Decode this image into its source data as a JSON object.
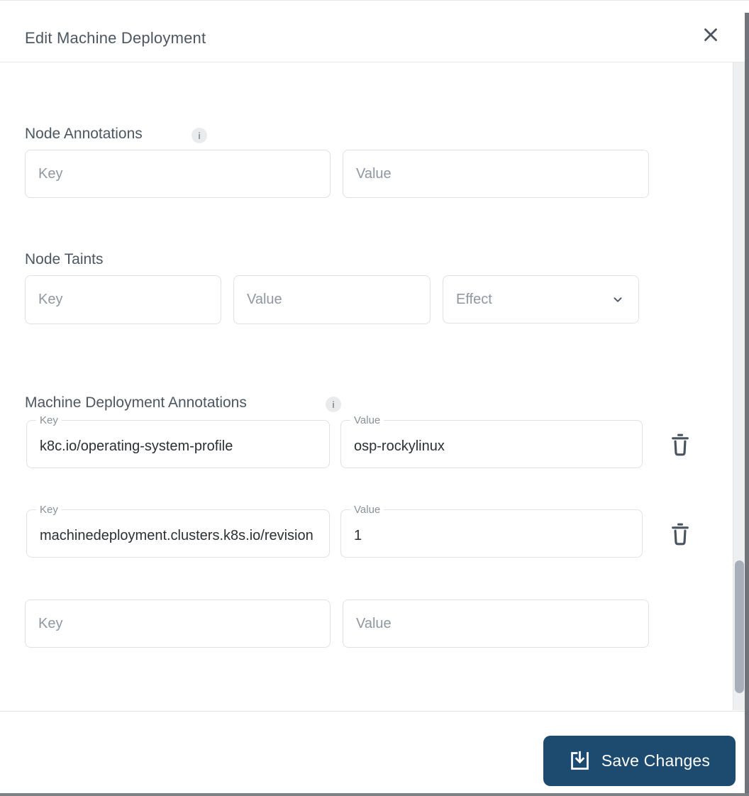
{
  "dialog": {
    "title": "Edit Machine Deployment",
    "info_glyph": "i"
  },
  "node_annotations": {
    "heading": "Node Annotations",
    "key_placeholder": "Key",
    "value_placeholder": "Value"
  },
  "node_taints": {
    "heading": "Node Taints",
    "key_placeholder": "Key",
    "value_placeholder": "Value",
    "effect_placeholder": "Effect"
  },
  "md_annotations": {
    "heading": "Machine Deployment Annotations",
    "rows": [
      {
        "key_label": "Key",
        "key": "k8c.io/operating-system-profile",
        "value_label": "Value",
        "value": "osp-rockylinux"
      },
      {
        "key_label": "Key",
        "key": "machinedeployment.clusters.k8s.io/revision",
        "value_label": "Value",
        "value": "1"
      }
    ],
    "new_row": {
      "key_placeholder": "Key",
      "value_placeholder": "Value"
    }
  },
  "footer": {
    "save_label": "Save Changes"
  },
  "colors": {
    "primary_button": "#1d4b70",
    "heading_text": "#4d5761",
    "icon": "#4d5a66",
    "field_border": "#dfe1e3",
    "placeholder_text": "#9097a0",
    "scroll_thumb": "#a8afba"
  }
}
